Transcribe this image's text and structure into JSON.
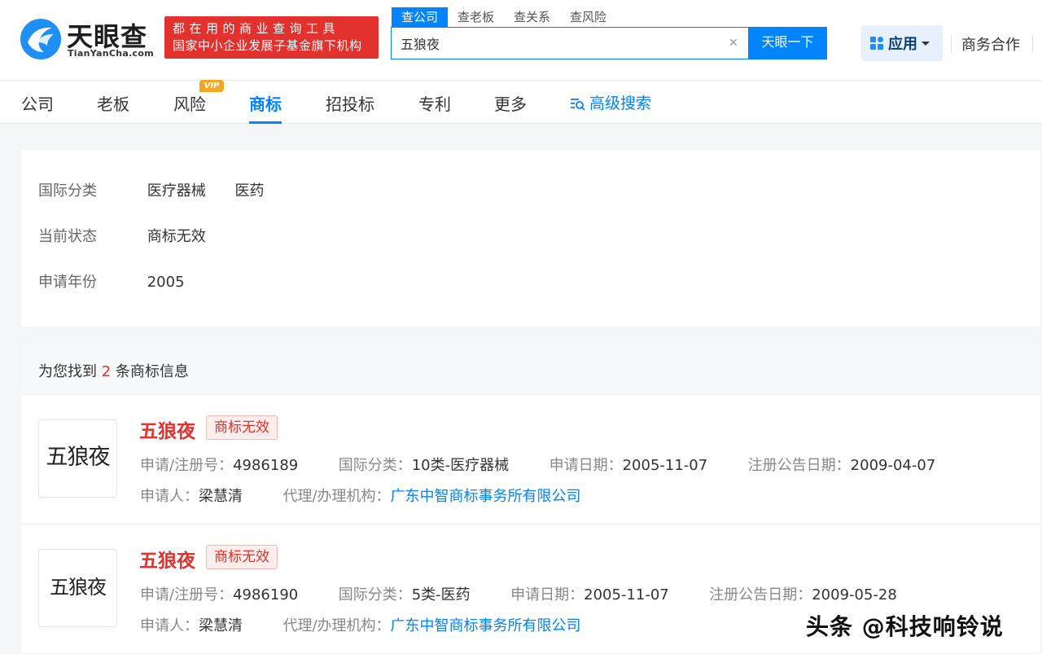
{
  "brand": {
    "name_cn": "天眼查",
    "name_en": "TianYanCha.com",
    "slogan_line1": "都在用的商业查询工具",
    "slogan_line2": "国家中小企业发展子基金旗下机构"
  },
  "search": {
    "tabs": [
      "查公司",
      "查老板",
      "查关系",
      "查风险"
    ],
    "active_tab": 0,
    "query": "五狼夜",
    "clear_icon": "close-icon",
    "button_label": "天眼一下"
  },
  "header": {
    "apps_label": "应用",
    "business_label": "商务合作"
  },
  "nav": {
    "items": [
      "公司",
      "老板",
      "风险",
      "商标",
      "招投标",
      "专利",
      "更多"
    ],
    "active_index": 3,
    "vip_badge": "VIP",
    "advanced_search": "高级搜索"
  },
  "filters": [
    {
      "label": "国际分类",
      "values": [
        "医疗器械",
        "医药"
      ]
    },
    {
      "label": "当前状态",
      "values": [
        "商标无效"
      ]
    },
    {
      "label": "申请年份",
      "values": [
        "2005"
      ]
    }
  ],
  "results": {
    "prefix": "为您找到",
    "count": "2",
    "suffix": "条商标信息",
    "items": [
      {
        "thumb_text": "五狼夜",
        "name": "五狼夜",
        "status": "商标无效",
        "reg_no_label": "申请/注册号：",
        "reg_no": "4986189",
        "class_label": "国际分类：",
        "class": "10类-医疗器械",
        "apply_date_label": "申请日期：",
        "apply_date": "2005-11-07",
        "pub_date_label": "注册公告日期：",
        "pub_date": "2009-04-07",
        "applicant_label": "申请人：",
        "applicant": "梁慧清",
        "agent_label": "代理/办理机构：",
        "agent": "广东中智商标事务所有限公司"
      },
      {
        "thumb_text": "五狼夜",
        "name": "五狼夜",
        "status": "商标无效",
        "reg_no_label": "申请/注册号：",
        "reg_no": "4986190",
        "class_label": "国际分类：",
        "class": "5类-医药",
        "apply_date_label": "申请日期：",
        "apply_date": "2005-11-07",
        "pub_date_label": "注册公告日期：",
        "pub_date": "2009-05-28",
        "applicant_label": "申请人：",
        "applicant": "梁慧清",
        "agent_label": "代理/办理机构：",
        "agent": "广东中智商标事务所有限公司"
      }
    ]
  },
  "watermark": "头条 @科技响铃说",
  "colors": {
    "accent": "#0084ff",
    "danger": "#e3312d",
    "vip": "#f5a623"
  }
}
